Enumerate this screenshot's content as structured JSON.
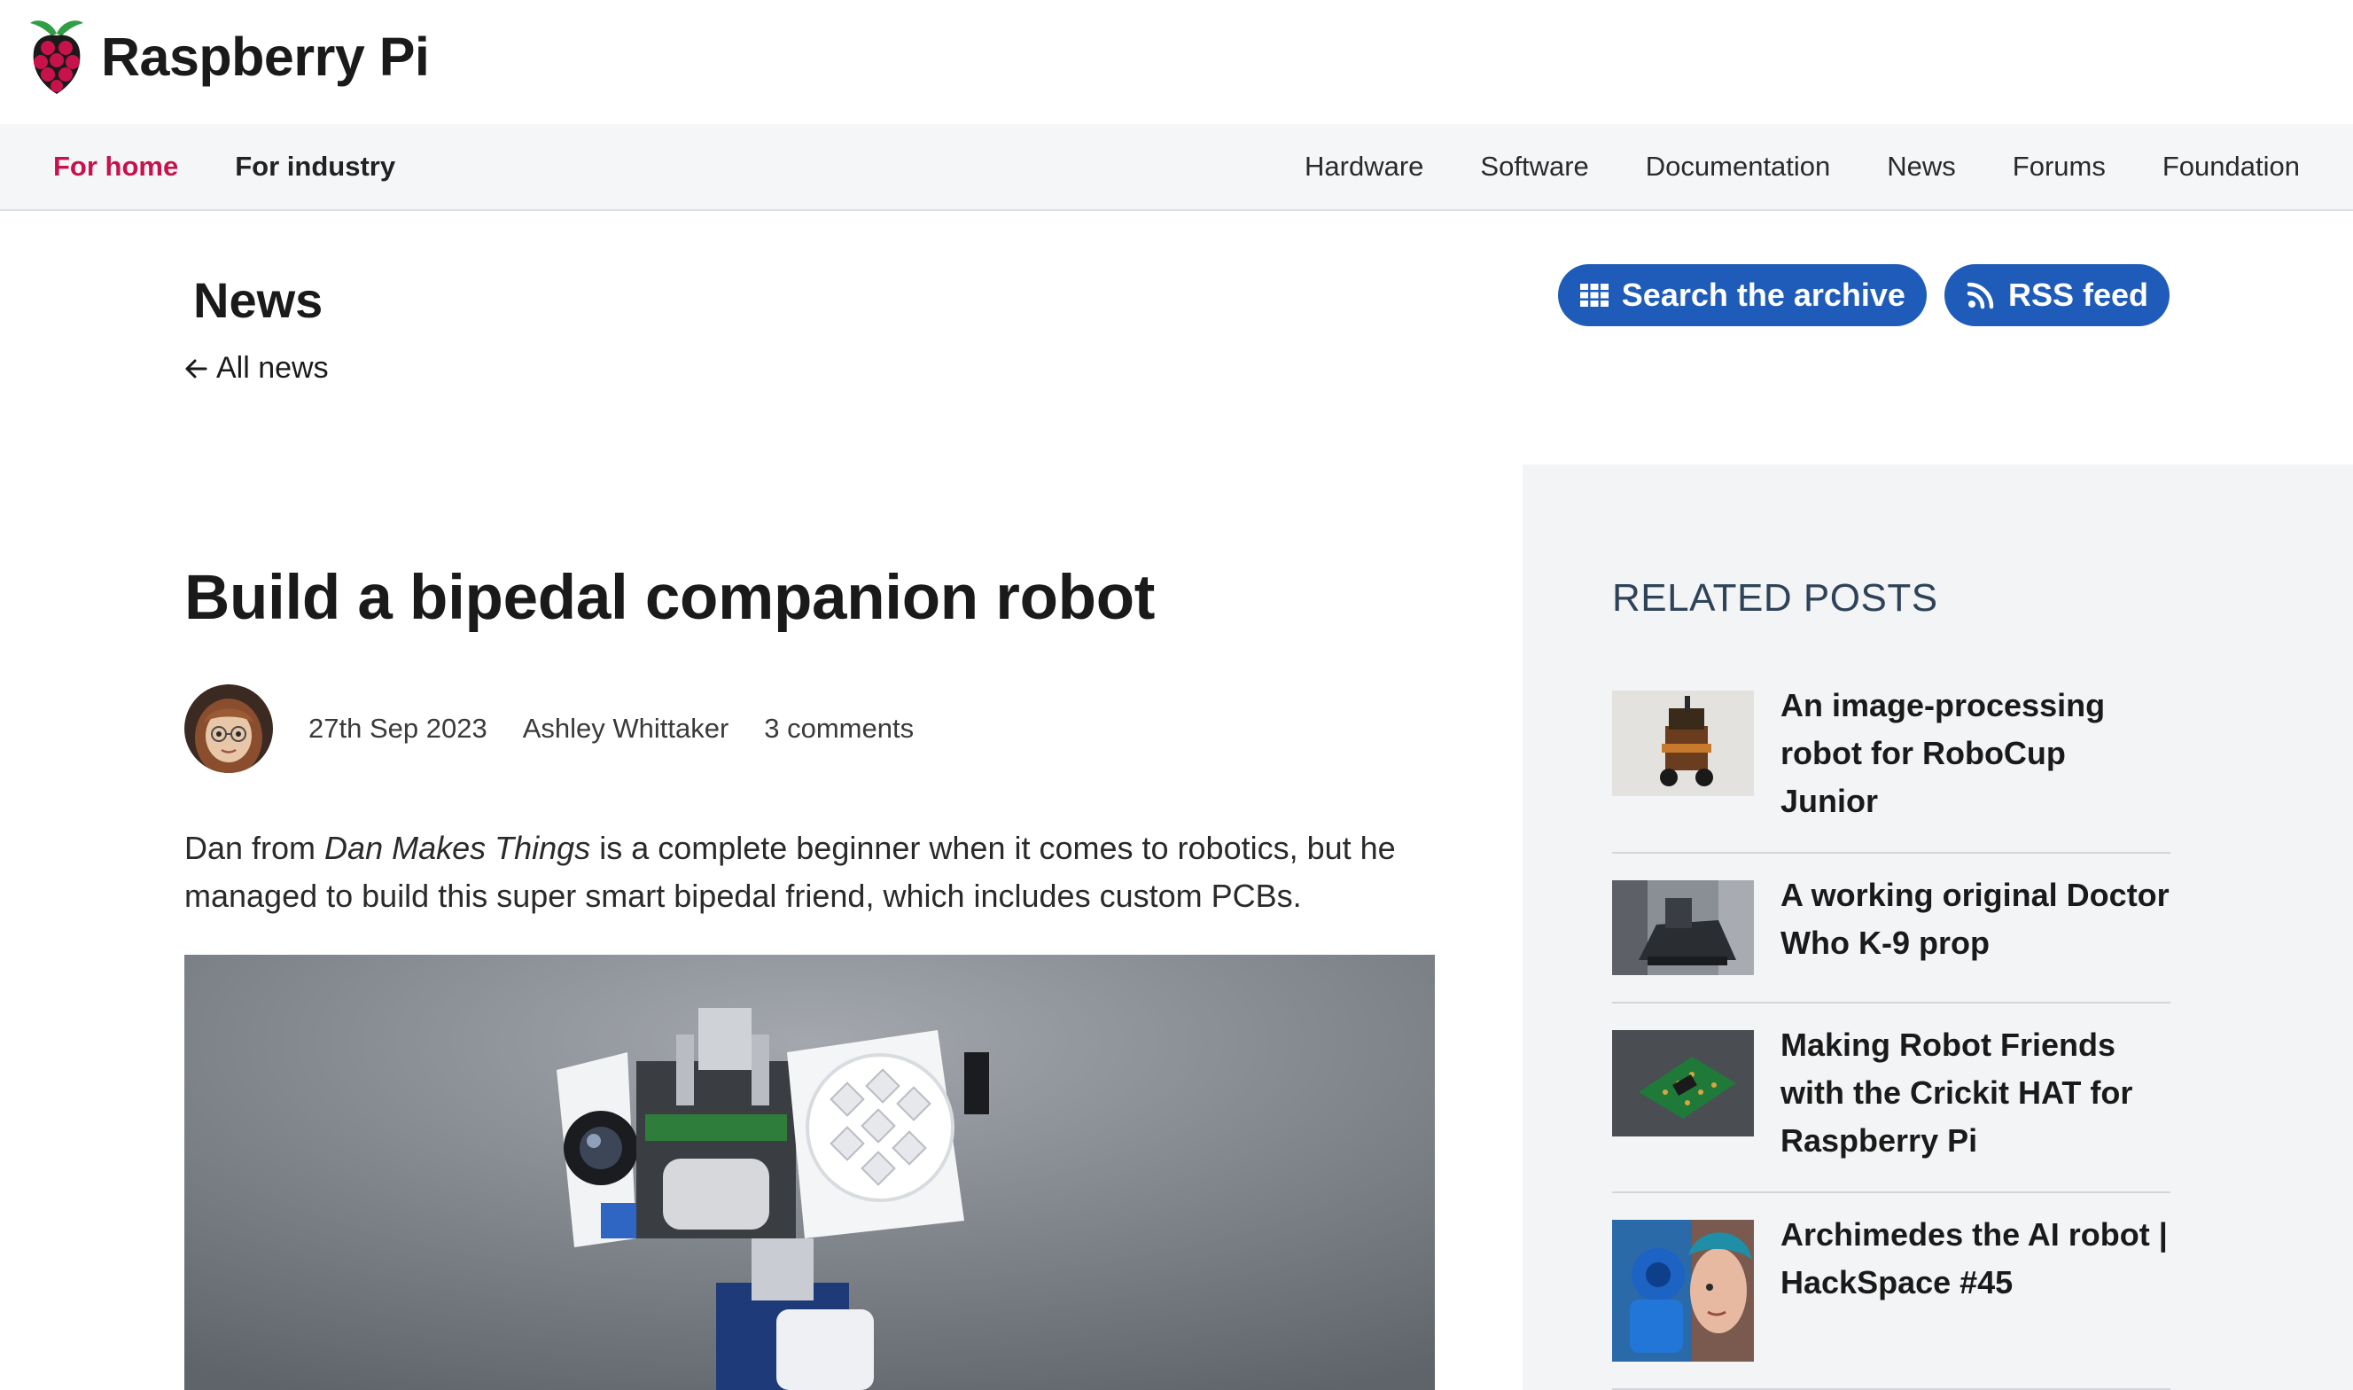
{
  "brand": {
    "name": "Raspberry Pi",
    "logo_icon": "raspberry-logo-icon"
  },
  "nav": {
    "left": [
      {
        "label": "For home",
        "active": true
      },
      {
        "label": "For industry",
        "active": false
      }
    ],
    "right": [
      "Hardware",
      "Software",
      "Documentation",
      "News",
      "Forums",
      "Foundation"
    ]
  },
  "news_header": {
    "title": "News",
    "back_link": "All news",
    "back_icon": "arrow-left-icon",
    "buttons": [
      {
        "label": "Search the archive",
        "icon": "grid-icon"
      },
      {
        "label": "RSS feed",
        "icon": "rss-icon"
      }
    ]
  },
  "article": {
    "title": "Build a bipedal companion robot",
    "date": "27th Sep 2023",
    "author": "Ashley Whittaker",
    "comments": "3 comments",
    "intro_pre": "Dan from ",
    "intro_em": "Dan Makes Things",
    "intro_post": " is a complete beginner when it comes to robotics, but he managed to build this super smart bipedal friend, which includes custom PCBs."
  },
  "sidebar": {
    "heading": "RELATED POSTS",
    "posts": [
      {
        "title": "An image-processing robot for RoboCup Junior"
      },
      {
        "title": "A working original Doctor Who K-9 prop"
      },
      {
        "title": "Making Robot Friends with the Crickit HAT for Raspberry Pi"
      },
      {
        "title": "Archimedes the AI robot | HackSpace #45"
      }
    ]
  },
  "colors": {
    "accent": "#c7124b",
    "button_blue": "#1f5bb8",
    "sidebar_heading": "#2e4358",
    "sidebar_bg": "#f3f4f6"
  }
}
